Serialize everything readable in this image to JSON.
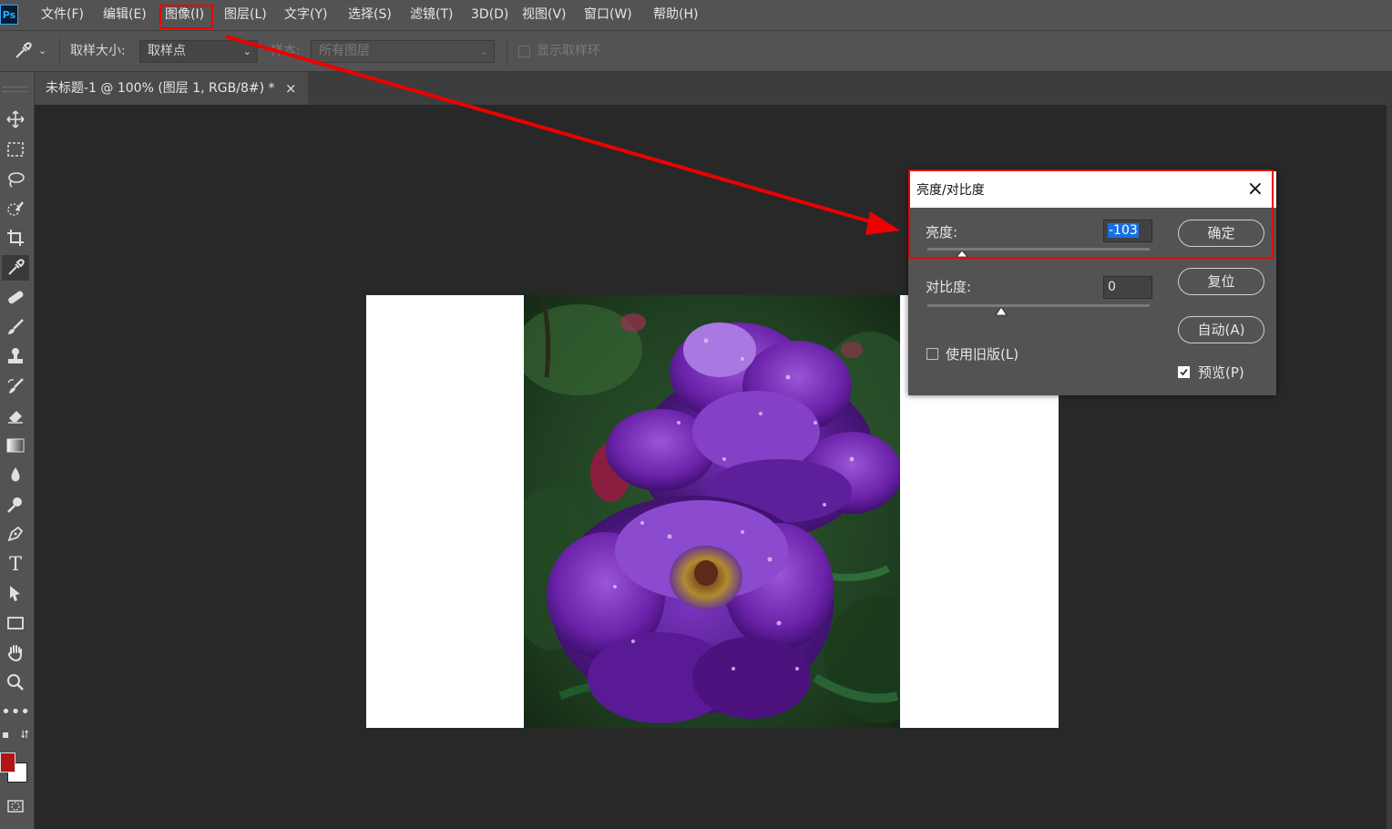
{
  "app": {
    "logo": "Ps"
  },
  "menu": [
    {
      "label": "文件(F)"
    },
    {
      "label": "编辑(E)"
    },
    {
      "label": "图像(I)"
    },
    {
      "label": "图层(L)"
    },
    {
      "label": "文字(Y)"
    },
    {
      "label": "选择(S)"
    },
    {
      "label": "滤镜(T)"
    },
    {
      "label": "3D(D)"
    },
    {
      "label": "视图(V)"
    },
    {
      "label": "窗口(W)"
    },
    {
      "label": "帮助(H)"
    }
  ],
  "options": {
    "tool_icon": "eyedropper-icon",
    "sample_size_label": "取样大小:",
    "sample_size_value": "取样点",
    "sample_label": "样本:",
    "sample_value": "所有图层",
    "show_ring_label": "显示取样环",
    "show_ring_checked": false
  },
  "document_tab": {
    "title": "未标题-1 @ 100% (图层 1, RGB/8#) *",
    "close": "×"
  },
  "tools": [
    "move-icon",
    "marquee-icon",
    "lasso-icon",
    "quick-select-icon",
    "crop-icon",
    "eyedropper-icon",
    "healing-icon",
    "brush-icon",
    "stamp-icon",
    "history-brush-icon",
    "eraser-icon",
    "gradient-icon",
    "blur-icon",
    "dodge-icon",
    "pen-icon",
    "type-icon",
    "path-select-icon",
    "rectangle-icon",
    "hand-icon",
    "zoom-icon",
    "more-icon"
  ],
  "colors": {
    "foreground": "#b01414",
    "background": "#ffffff",
    "highlight": "#ee0000"
  },
  "dialog": {
    "title": "亮度/对比度",
    "close": "×",
    "brightness_label": "亮度:",
    "brightness_value": "-103",
    "brightness_level": -103,
    "contrast_label": "对比度:",
    "contrast_value": "0",
    "contrast_level": 0,
    "legacy_label": "使用旧版(L)",
    "legacy_checked": false,
    "ok_label": "确定",
    "reset_label": "复位",
    "auto_label": "自动(A)",
    "preview_label": "预览(P)",
    "preview_checked": true
  }
}
